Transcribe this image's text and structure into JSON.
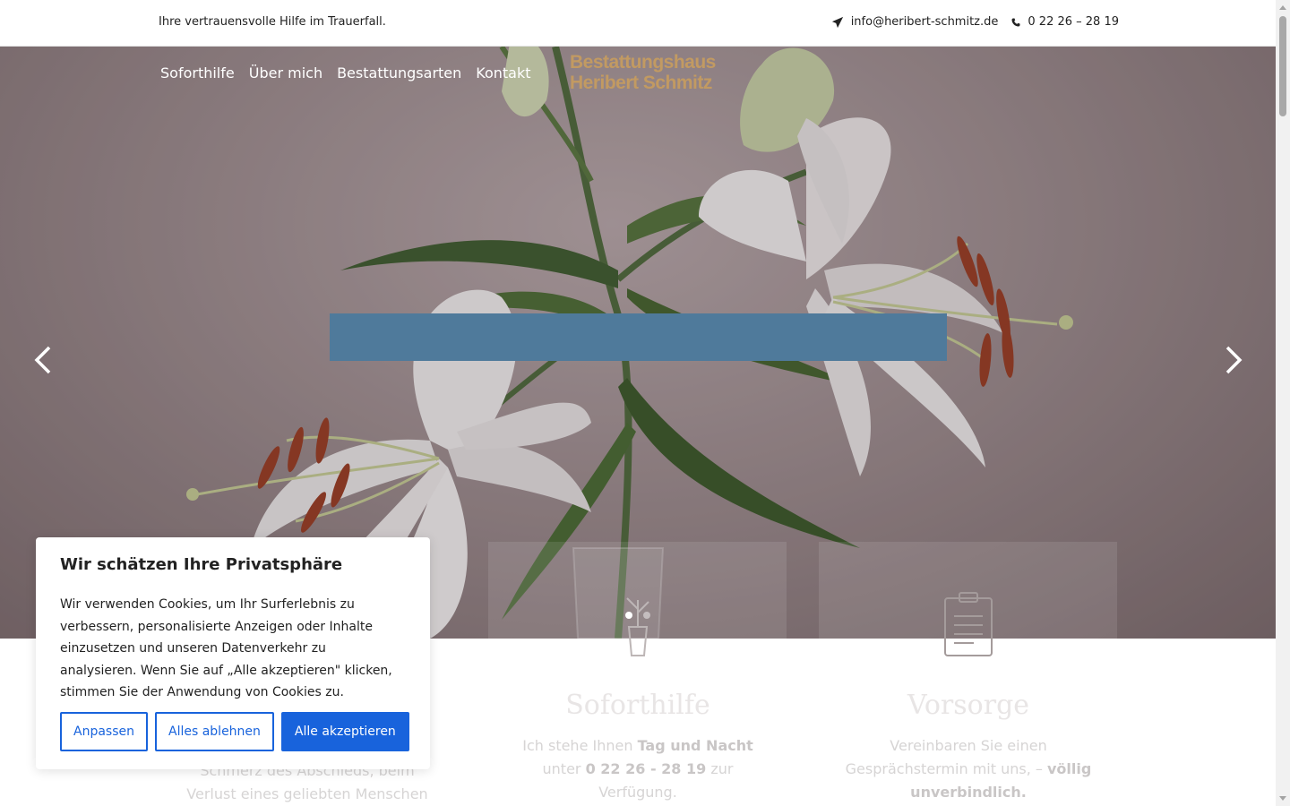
{
  "topbar": {
    "tagline": "Ihre vertrauensvolle Hilfe im Trauerfall.",
    "email": "info@heribert-schmitz.de",
    "email_icon": "paper-plane-icon",
    "phone": "0 22 26 – 28 19",
    "phone_icon": "phone-icon"
  },
  "nav": {
    "items": [
      {
        "label": "Soforthilfe"
      },
      {
        "label": "Über mich"
      },
      {
        "label": "Bestattungsarten"
      },
      {
        "label": "Kontakt"
      }
    ]
  },
  "logo": {
    "line1": "Bestattungshaus",
    "line2": "Heribert Schmitz"
  },
  "slider": {
    "prev_icon": "chevron-left-icon",
    "next_icon": "chevron-right-icon",
    "slides": 2,
    "active_slide": 1
  },
  "cards": [
    {
      "icon": "hands-icon",
      "text_lines": [
        "Schmerz des Abschieds, beim",
        "Verlust eines geliebten Menschen"
      ]
    },
    {
      "icon": "flower-vase-icon",
      "title": "Soforthilfe",
      "text_pre": "Ich stehe Ihnen ",
      "text_bold1": "Tag und Nacht",
      "text_mid": " unter ",
      "text_bold2": "0 22 26 - 28 19",
      "text_post": " zur Verfügung."
    },
    {
      "icon": "clipboard-icon",
      "title": "Vorsorge",
      "text_pre": "Vereinbaren Sie einen Gesprächstermin mit uns, –",
      "text_bold1": "völlig unverbindlich."
    }
  ],
  "cookie": {
    "title": "Wir schätzen Ihre Privatsphäre",
    "text": "Wir verwenden Cookies, um Ihr Surferlebnis zu verbessern, personalisierte Anzeigen oder Inhalte einzusetzen und unseren Datenverkehr zu analysieren. Wenn Sie auf „Alle akzeptieren\" klicken, stimmen Sie der Anwendung von Cookies zu.",
    "btn_customize": "Anpassen",
    "btn_reject": "Alles ablehnen",
    "btn_accept": "Alle akzeptieren"
  },
  "colors": {
    "brand_gold": "#c29a62",
    "caption_blue": "#4f7a9b",
    "cookie_blue": "#1863dc"
  }
}
